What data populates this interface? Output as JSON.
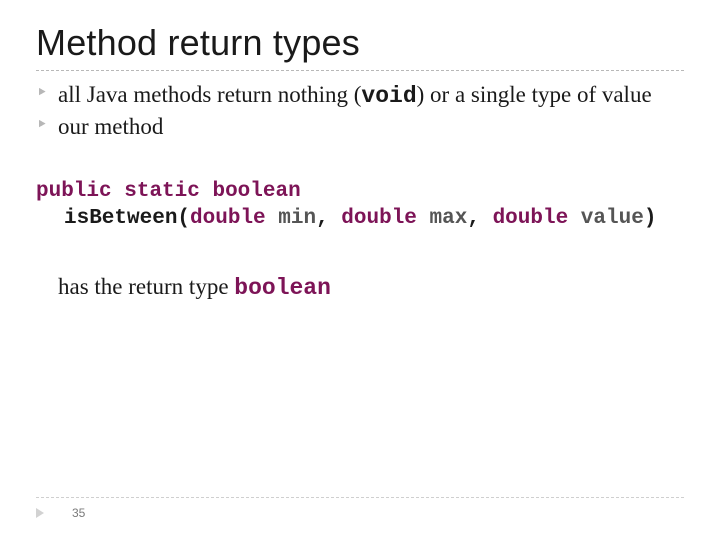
{
  "title": "Method return types",
  "bullets": [
    {
      "pre": "all Java methods return nothing (",
      "code": "void",
      "post": ") or a single type of value"
    },
    {
      "pre": "our method",
      "code": "",
      "post": ""
    }
  ],
  "code": {
    "l1_kw1": "public",
    "l1_sp1": " ",
    "l1_kw2": "static",
    "l1_sp2": " ",
    "l1_kw3": "boolean",
    "l2_name": "isBetween",
    "l2_p1": "(",
    "l2_kw1": "double",
    "l2_arg1": " min",
    "l2_c1": ", ",
    "l2_kw2": "double",
    "l2_arg2": " max",
    "l2_c2": ", ",
    "l2_kw3": "double",
    "l2_arg3": " value",
    "l2_p2": ")"
  },
  "closing": {
    "pre": "has the return type ",
    "kw": "boolean"
  },
  "page": "35"
}
